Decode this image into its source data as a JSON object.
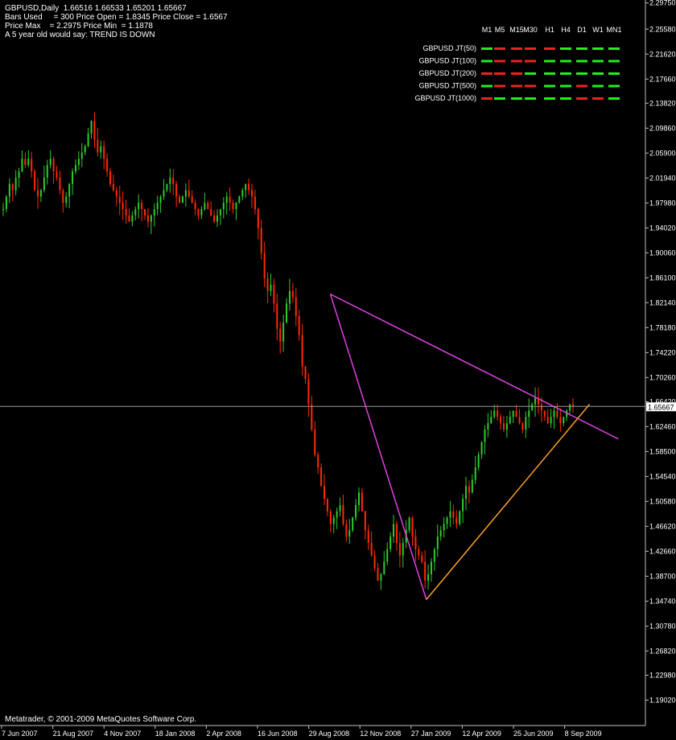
{
  "info": {
    "line1": "GBPUSD,Daily  1.66516 1.66533 1.65201 1.65667",
    "line2": "Bars Used     = 300 Price Open = 1.8345 Price Close = 1.6567",
    "line3": "Price Max    = 2.2975 Price Min  = 1.1878",
    "line4": "A 5 year old would say: TREND IS DOWN"
  },
  "copyright": "Metatrader, © 2001-2009 MetaQuotes Software Corp.",
  "colors": {
    "background": "#000000",
    "bull_candle": "#2ecc2e",
    "bear_candle": "#ff2a00",
    "trend_magenta": "#e040e0",
    "trend_orange": "#ffa020",
    "indicator_green": "#22ee22",
    "indicator_red": "#ee2222",
    "current_line": "#9a9a9a"
  },
  "matrix": {
    "timeframes": [
      "M1",
      "M5",
      "M15",
      "M30",
      "H1",
      "H4",
      "D1",
      "W1",
      "MN1"
    ],
    "rows": [
      {
        "label": "GBPUSD JT(50)",
        "states": [
          "g",
          "r",
          "r",
          "r",
          "r",
          "g",
          "g",
          "g",
          "g"
        ]
      },
      {
        "label": "GBPUSD JT(100)",
        "states": [
          "g",
          "r",
          "r",
          "r",
          "g",
          "g",
          "g",
          "g",
          "g"
        ]
      },
      {
        "label": "GBPUSD JT(200)",
        "states": [
          "r",
          "r",
          "r",
          "g",
          "g",
          "g",
          "g",
          "g",
          "g"
        ]
      },
      {
        "label": "GBPUSD JT(500)",
        "states": [
          "g",
          "r",
          "r",
          "r",
          "g",
          "g",
          "r",
          "g",
          "g"
        ]
      },
      {
        "label": "GBPUSD JT(1000)",
        "states": [
          "r",
          "g",
          "g",
          "g",
          "g",
          "g",
          "r",
          "r",
          "g"
        ]
      }
    ]
  },
  "chart_data": {
    "type": "candlestick",
    "symbol": "GBPUSD",
    "timeframe": "Daily",
    "current_price": 1.65667,
    "current_price_label": "1.65667",
    "ylim": [
      1.155,
      2.297
    ],
    "price_ticks": [
      "2.29750",
      "2.25580",
      "2.21620",
      "2.17660",
      "2.13820",
      "2.09860",
      "2.05900",
      "2.01940",
      "1.97980",
      "1.94020",
      "1.90060",
      "1.86100",
      "1.82140",
      "1.78180",
      "1.74220",
      "1.70260",
      "1.66420",
      "1.62460",
      "1.58500",
      "1.54540",
      "1.50580",
      "1.46620",
      "1.42660",
      "1.38700",
      "1.34740",
      "1.30780",
      "1.26820",
      "1.22980",
      "1.19020"
    ],
    "date_ticks": [
      "7 Jun 2007",
      "21 Aug 2007",
      "4 Nov 2007",
      "18 Jan 2008",
      "2 Apr 2008",
      "16 Jun 2008",
      "29 Aug 2008",
      "12 Nov 2008",
      "27 Jan 2009",
      "12 Apr 2009",
      "25 Jun 2009",
      "8 Sep 2009"
    ],
    "trendlines": [
      {
        "name": "upper-resistance",
        "color": "magenta",
        "from": {
          "date": "2008-09-05",
          "price": 1.835
        },
        "to": {
          "date": "2009-10-30",
          "price": 1.605
        }
      },
      {
        "name": "down-leg",
        "color": "magenta",
        "from": {
          "date": "2008-09-05",
          "price": 1.835
        },
        "to": {
          "date": "2009-01-23",
          "price": 1.35
        }
      },
      {
        "name": "up-support",
        "color": "orange",
        "from": {
          "date": "2009-01-23",
          "price": 1.35
        },
        "to": {
          "date": "2009-09-18",
          "price": 1.66
        }
      }
    ],
    "closes": [
      1.97,
      1.99,
      2.01,
      2.0,
      2.02,
      2.03,
      2.05,
      2.04,
      2.05,
      2.03,
      2.0,
      1.99,
      2.0,
      2.02,
      2.04,
      2.05,
      2.03,
      2.02,
      2.0,
      1.98,
      1.99,
      2.01,
      2.03,
      2.04,
      2.05,
      2.06,
      2.07,
      2.09,
      2.11,
      2.08,
      2.06,
      2.07,
      2.05,
      2.03,
      2.01,
      2.0,
      1.99,
      1.98,
      1.97,
      1.96,
      1.95,
      1.96,
      1.97,
      1.98,
      1.97,
      1.96,
      1.95,
      1.96,
      1.97,
      1.98,
      1.99,
      2.0,
      2.01,
      2.02,
      2.01,
      1.99,
      1.98,
      1.99,
      2.0,
      1.99,
      1.98,
      1.97,
      1.96,
      1.97,
      1.98,
      1.97,
      1.96,
      1.95,
      1.96,
      1.97,
      1.98,
      1.99,
      1.98,
      1.97,
      1.98,
      1.99,
      2.0,
      2.01,
      2.0,
      1.99,
      1.97,
      1.94,
      1.9,
      1.86,
      1.84,
      1.85,
      1.82,
      1.78,
      1.76,
      1.79,
      1.82,
      1.84,
      1.83,
      1.8,
      1.77,
      1.72,
      1.7,
      1.66,
      1.62,
      1.58,
      1.56,
      1.53,
      1.51,
      1.49,
      1.47,
      1.48,
      1.49,
      1.5,
      1.47,
      1.45,
      1.46,
      1.48,
      1.5,
      1.52,
      1.49,
      1.46,
      1.44,
      1.42,
      1.4,
      1.38,
      1.39,
      1.41,
      1.43,
      1.45,
      1.47,
      1.44,
      1.42,
      1.44,
      1.46,
      1.48,
      1.45,
      1.43,
      1.42,
      1.41,
      1.38,
      1.39,
      1.41,
      1.43,
      1.45,
      1.46,
      1.47,
      1.48,
      1.49,
      1.48,
      1.47,
      1.49,
      1.51,
      1.53,
      1.52,
      1.54,
      1.56,
      1.58,
      1.6,
      1.62,
      1.63,
      1.64,
      1.65,
      1.64,
      1.63,
      1.62,
      1.63,
      1.64,
      1.65,
      1.64,
      1.63,
      1.62,
      1.64,
      1.65,
      1.66,
      1.67,
      1.66,
      1.65,
      1.64,
      1.63,
      1.64,
      1.65,
      1.64,
      1.63,
      1.64,
      1.65,
      1.66,
      1.657
    ]
  }
}
